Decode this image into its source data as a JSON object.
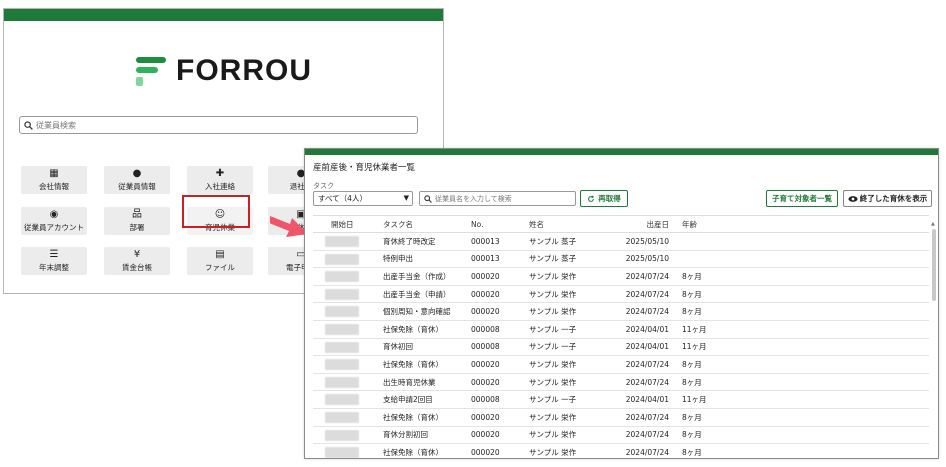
{
  "home": {
    "logo_text": "FORROU",
    "search_placeholder": "従業員検索",
    "tiles": [
      {
        "label": "会社情報",
        "icon": "building-icon",
        "glyph": "▦"
      },
      {
        "label": "従業員情報",
        "icon": "person-icon",
        "glyph": "●"
      },
      {
        "label": "入社連絡",
        "icon": "person-add-icon",
        "glyph": "✚"
      },
      {
        "label": "退社連",
        "icon": "person-remove-icon",
        "glyph": "●"
      },
      {
        "label": "従業員アカウント",
        "icon": "account-circle-icon",
        "glyph": "◉"
      },
      {
        "label": "部署",
        "icon": "org-chart-icon",
        "glyph": "品"
      },
      {
        "label": "育児休業",
        "icon": "baby-icon",
        "glyph": "☺"
      },
      {
        "label": "休",
        "icon": "calendar-icon",
        "glyph": "▣"
      },
      {
        "label": "年末調整",
        "icon": "tune-icon",
        "glyph": "☰"
      },
      {
        "label": "賃金台帳",
        "icon": "yen-ledger-icon",
        "glyph": "¥"
      },
      {
        "label": "ファイル",
        "icon": "file-icon",
        "glyph": "▤"
      },
      {
        "label": "電子申請",
        "icon": "monitor-icon",
        "glyph": "▭"
      }
    ]
  },
  "list": {
    "title": "産前産後・育児休業者一覧",
    "task_label": "タスク",
    "task_select_value": "すべて（4人）",
    "search_placeholder": "従業員名を入力して検索",
    "reload_label": "再取得",
    "target_button_label": "子育て対象者一覧",
    "show_finished_label": "終了した育休を表示",
    "columns": [
      "開始日",
      "タスク名",
      "No.",
      "姓名",
      "出産日",
      "年齢"
    ],
    "rows": [
      {
        "task": "育休終了時改定",
        "no": "000013",
        "name": "サンプル 蒸子",
        "birth": "2025/05/10",
        "age": ""
      },
      {
        "task": "特例申出",
        "no": "000013",
        "name": "サンプル 蒸子",
        "birth": "2025/05/10",
        "age": ""
      },
      {
        "task": "出産手当金（作成）",
        "no": "000020",
        "name": "サンプル 栄作",
        "birth": "2024/07/24",
        "age": "8ヶ月"
      },
      {
        "task": "出産手当金（申請）",
        "no": "000020",
        "name": "サンプル 栄作",
        "birth": "2024/07/24",
        "age": "8ヶ月"
      },
      {
        "task": "個別周知・意向確認",
        "no": "000020",
        "name": "サンプル 栄作",
        "birth": "2024/07/24",
        "age": "8ヶ月"
      },
      {
        "task": "社保免除（育休）",
        "no": "000008",
        "name": "サンプル 一子",
        "birth": "2024/04/01",
        "age": "11ヶ月"
      },
      {
        "task": "育休初回",
        "no": "000008",
        "name": "サンプル 一子",
        "birth": "2024/04/01",
        "age": "11ヶ月"
      },
      {
        "task": "社保免除（育休）",
        "no": "000020",
        "name": "サンプル 栄作",
        "birth": "2024/07/24",
        "age": "8ヶ月"
      },
      {
        "task": "出生時育児休業",
        "no": "000020",
        "name": "サンプル 栄作",
        "birth": "2024/07/24",
        "age": "8ヶ月"
      },
      {
        "task": "支給申請2回目",
        "no": "000008",
        "name": "サンプル 一子",
        "birth": "2024/04/01",
        "age": "11ヶ月"
      },
      {
        "task": "社保免除（育休）",
        "no": "000020",
        "name": "サンプル 栄作",
        "birth": "2024/07/24",
        "age": "8ヶ月"
      },
      {
        "task": "育休分割初回",
        "no": "000020",
        "name": "サンプル 栄作",
        "birth": "2024/07/24",
        "age": "8ヶ月"
      },
      {
        "task": "社保免除（育休）",
        "no": "000020",
        "name": "サンプル 栄作",
        "birth": "2024/07/24",
        "age": "8ヶ月"
      }
    ]
  },
  "colors": {
    "brand_green": "#1e7a38",
    "highlight_red": "#cc2020",
    "arrow": "#f0566a"
  }
}
